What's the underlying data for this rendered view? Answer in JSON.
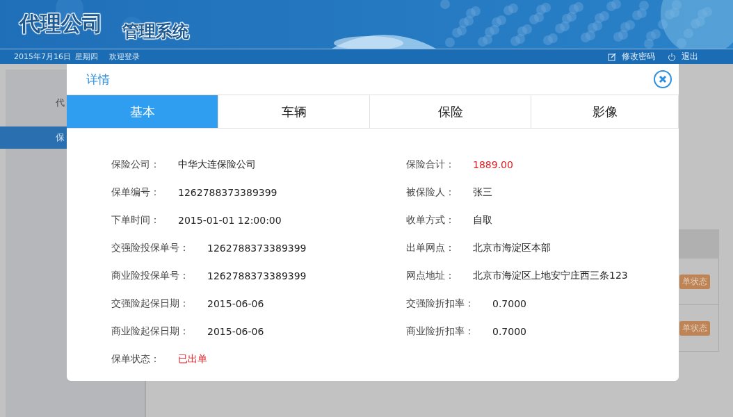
{
  "header": {
    "logo_main": "代理公司",
    "logo_sub": "管理系统",
    "date": "2015年7月16日",
    "weekday": "星期四",
    "welcome": "欢迎登录",
    "actions": [
      {
        "kind": "password",
        "label": "修改密码"
      },
      {
        "kind": "logout",
        "label": "退出"
      }
    ]
  },
  "sidebar": {
    "items": [
      {
        "label": "代",
        "selected": false
      },
      {
        "label": "保",
        "selected": true
      }
    ]
  },
  "background_table": {
    "rows": [
      {
        "badge": "单状态"
      },
      {
        "badge": "单状态"
      }
    ]
  },
  "dialog": {
    "title": "详情",
    "tabs": [
      {
        "label": "基本",
        "selected": true
      },
      {
        "label": "车辆",
        "selected": false
      },
      {
        "label": "保险",
        "selected": false
      },
      {
        "label": "影像",
        "selected": false
      }
    ],
    "left": [
      {
        "label": "保险公司：",
        "value": "中华大连保险公司",
        "highlight": false
      },
      {
        "label": "保单编号：",
        "value": "1262788373389399",
        "highlight": false
      },
      {
        "label": "下单时间：",
        "value": "2015-01-01 12:00:00",
        "highlight": false
      },
      {
        "label": "交强险投保单号：",
        "value": "1262788373389399",
        "highlight": false
      },
      {
        "label": "商业险投保单号：",
        "value": "1262788373389399",
        "highlight": false
      },
      {
        "label": "交强险起保日期：",
        "value": "2015-06-06",
        "highlight": false
      },
      {
        "label": "商业险起保日期：",
        "value": "2015-06-06",
        "highlight": false
      },
      {
        "label": "保单状态：",
        "value": "已出单",
        "highlight": true
      }
    ],
    "right": [
      {
        "label": "保险合计：",
        "value": "1889.00",
        "highlight": true
      },
      {
        "label": "被保险人：",
        "value": "张三",
        "highlight": false
      },
      {
        "label": "收单方式：",
        "value": "自取",
        "highlight": false
      },
      {
        "label": "出单网点：",
        "value": "北京市海淀区本部",
        "highlight": false
      },
      {
        "label": "网点地址：",
        "value": "北京市海淀区上地安宁庄西三条123",
        "highlight": false
      },
      {
        "label": "交强险折扣率：",
        "value": "0.7000",
        "highlight": false
      },
      {
        "label": "商业险折扣率：",
        "value": "0.7000",
        "highlight": false
      }
    ]
  }
}
